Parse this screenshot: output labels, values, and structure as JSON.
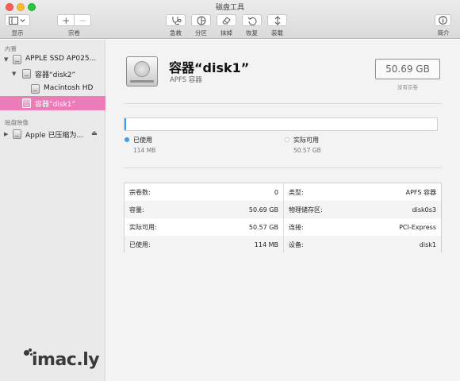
{
  "window": {
    "title": "磁盘工具"
  },
  "toolbar": {
    "view_label": "显示",
    "volume_label": "宗卷",
    "add_symbol": "+",
    "remove_symbol": "−",
    "rescue_label": "急救",
    "partition_label": "分区",
    "erase_label": "抹掉",
    "restore_label": "恢复",
    "mount_label": "装载",
    "info_label": "简介"
  },
  "sidebar": {
    "internal_section": "内置",
    "image_section": "磁盘映像",
    "items": [
      {
        "label": "APPLE SSD AP025..."
      },
      {
        "label": "容器“disk2”"
      },
      {
        "label": "Macintosh HD"
      },
      {
        "label": "容器“disk1”"
      },
      {
        "label": "Apple 已压缩为..."
      }
    ],
    "eject_symbol": "⏏"
  },
  "logo": {
    "text": "imac.ly"
  },
  "volume": {
    "title": "容器“disk1”",
    "subtitle": "APFS 容器",
    "size": "50.69 GB",
    "size_caption": "没有宗卷"
  },
  "usage": {
    "used_fraction": 0.0022,
    "used_label": "已使用",
    "used_value": "114 MB",
    "free_label": "实际可用",
    "free_value": "50.57 GB"
  },
  "colors": {
    "selection": "#ec7cb8",
    "used": "#3a9cf6",
    "free": "#ffffff"
  },
  "info": {
    "left": [
      {
        "key": "宗卷数:",
        "value": "0"
      },
      {
        "key": "容量:",
        "value": "50.69 GB"
      },
      {
        "key": "实际可用:",
        "value": "50.57 GB"
      },
      {
        "key": "已使用:",
        "value": "114 MB"
      }
    ],
    "right": [
      {
        "key": "类型:",
        "value": "APFS 容器"
      },
      {
        "key": "物理储存区:",
        "value": "disk0s3"
      },
      {
        "key": "连接:",
        "value": "PCI-Express"
      },
      {
        "key": "设备:",
        "value": "disk1"
      }
    ]
  }
}
